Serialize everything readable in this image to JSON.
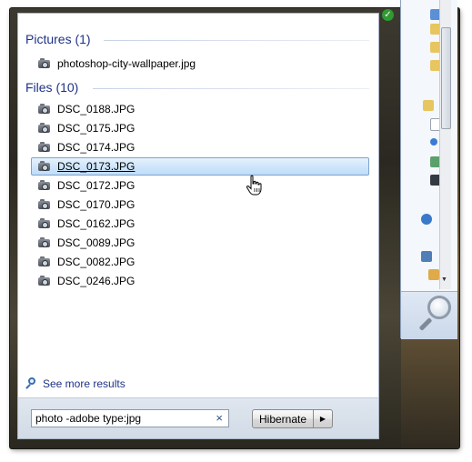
{
  "groups": {
    "pictures": {
      "header": "Pictures (1)",
      "items": [
        "photoshop-city-wallpaper.jpg"
      ]
    },
    "files": {
      "header": "Files (10)",
      "items": [
        "DSC_0188.JPG",
        "DSC_0175.JPG",
        "DSC_0174.JPG",
        "DSC_0173.JPG",
        "DSC_0172.JPG",
        "DSC_0170.JPG",
        "DSC_0162.JPG",
        "DSC_0089.JPG",
        "DSC_0082.JPG",
        "DSC_0246.JPG"
      ],
      "highlighted_item": "DSC_0173.JPG"
    }
  },
  "see_more": {
    "label": "See more results",
    "icon": "magnifier-icon"
  },
  "search": {
    "value": "photo -adobe type:jpg",
    "clear_icon": "×"
  },
  "power": {
    "label": "Hibernate",
    "arrow": "▶"
  },
  "colors": {
    "group_header": "#1e3287",
    "highlight_bg": "#cfe6fb",
    "highlight_border": "#7da2ce"
  }
}
